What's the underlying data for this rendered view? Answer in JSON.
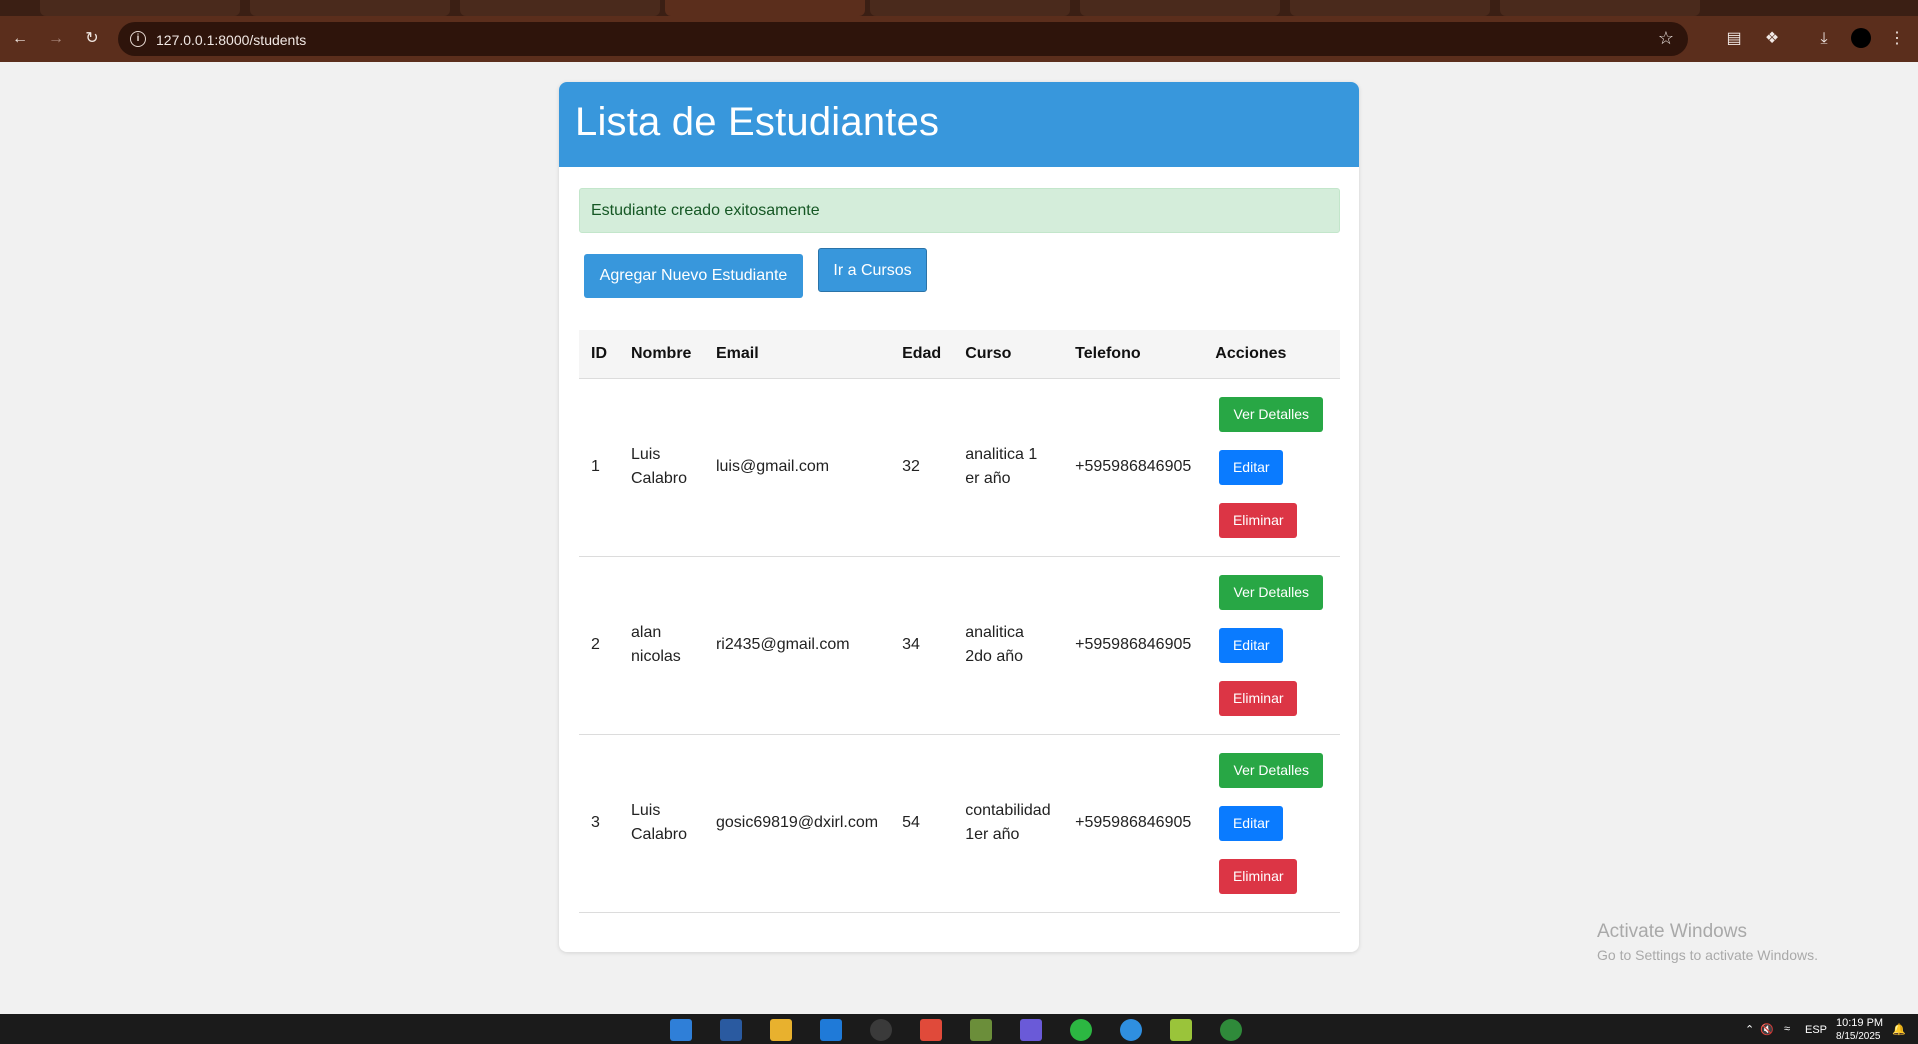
{
  "browser": {
    "url": "127.0.0.1:8000/students",
    "icons": [
      "back-arrow-icon",
      "forward-arrow-icon",
      "reload-icon",
      "site-info-icon",
      "bookmark-star-icon",
      "reading-list-icon",
      "extensions-icon",
      "download-icon",
      "more-vert-icon"
    ]
  },
  "page": {
    "title": "Lista de Estudiantes",
    "alert": "Estudiante creado exitosamente",
    "add_button": "Agregar Nuevo Estudiante",
    "courses_button": "Ir a Cursos",
    "colors": {
      "header": "#3897dc",
      "alert_bg": "#d4edda",
      "alert_text": "#155724",
      "green": "#28a745",
      "blue": "#0a7bff",
      "red": "#dc3545"
    }
  },
  "table": {
    "headers": [
      "ID",
      "Nombre",
      "Email",
      "Edad",
      "Curso",
      "Telefono",
      "Acciones"
    ],
    "rows": [
      {
        "id": "1",
        "name": "Luis Calabro",
        "email": "luis@gmail.com",
        "age": "32",
        "course": "analitica 1 er año",
        "phone": "+595986846905"
      },
      {
        "id": "2",
        "name": "alan nicolas",
        "email": "ri2435@gmail.com",
        "age": "34",
        "course": "analitica 2do año",
        "phone": "+595986846905"
      },
      {
        "id": "3",
        "name": "Luis Calabro",
        "email": "gosic69819@dxirl.com",
        "age": "54",
        "course": "contabilidad 1er año",
        "phone": "+595986846905"
      }
    ],
    "actions": {
      "details": "Ver Detalles",
      "edit": "Editar",
      "delete": "Eliminar"
    }
  },
  "watermark": {
    "line1": "Activate Windows",
    "line2": "Go to Settings to activate Windows."
  },
  "taskbar": {
    "lang": "ESP",
    "time": "10:19 PM",
    "date": "8/15/2025"
  }
}
